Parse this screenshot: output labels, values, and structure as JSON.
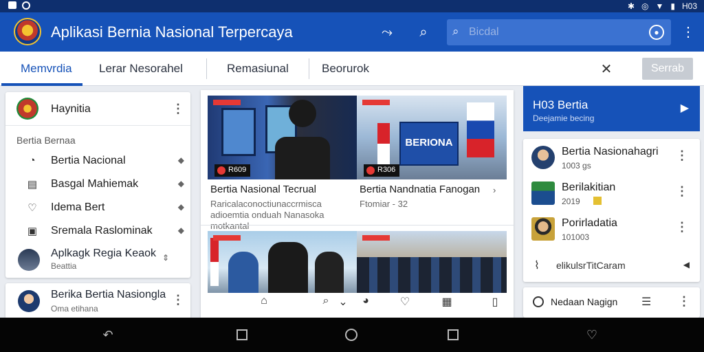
{
  "status_bar": {
    "time": "H03"
  },
  "app": {
    "title": "Aplikasi Bernia Nasional Terpercaya"
  },
  "search": {
    "placeholder": "Bicdal"
  },
  "tabs": [
    {
      "label": "Memvrdia",
      "active": true
    },
    {
      "label": "Lerar Nesorahel",
      "active": false
    },
    {
      "label": "Remasiunal",
      "active": false
    },
    {
      "label": "Beorurok",
      "active": false
    }
  ],
  "tab_button": "Serrab",
  "sidebar": {
    "header": "Haynitia",
    "section": "Bertia Bernaa",
    "items": [
      {
        "label": "Bertia Nacional",
        "icon": "globe-icon"
      },
      {
        "label": "Basgal Mahiemak",
        "icon": "calendar-icon"
      },
      {
        "label": "Idema Bert",
        "icon": "shield-icon"
      },
      {
        "label": "Sremala Raslominak",
        "icon": "box-icon"
      }
    ],
    "app_item": {
      "title": "Aplkagk Regia Keaok",
      "sub": "Beattia"
    },
    "bottom_item": {
      "title": "Berika Bertia Nasiongla",
      "sub": "Oma etihana"
    }
  },
  "news": [
    {
      "title": "Bertia Nasional Tecrual",
      "sub": "Raricalaconoctiunaccrmisca adioemtia onduah Nanasoka motkantal",
      "tag": "R609"
    },
    {
      "title": "Bertia Nandnatia Fanogan",
      "sub": "Ftomiar - 32",
      "tag": "R306",
      "banner": "BERIONA"
    },
    {
      "title": "",
      "sub": "",
      "tag": ""
    },
    {
      "title": "",
      "sub": "",
      "tag": ""
    }
  ],
  "promo": {
    "title": "H03 Bertia",
    "sub": "Deejamie becing"
  },
  "trending": [
    {
      "title": "Bertia Nasionahagri",
      "sub": "1003 gs"
    },
    {
      "title": "Berilakitian",
      "sub": "2019"
    },
    {
      "title": "Porirladatia",
      "sub": "101003"
    }
  ],
  "trending_footer": "elikulsrTitCaram",
  "bottom_card": "Nedaan Nagign",
  "colors": {
    "primary": "#1652b8",
    "statusbar": "#0e2f6e",
    "accent_red": "#e53935"
  }
}
